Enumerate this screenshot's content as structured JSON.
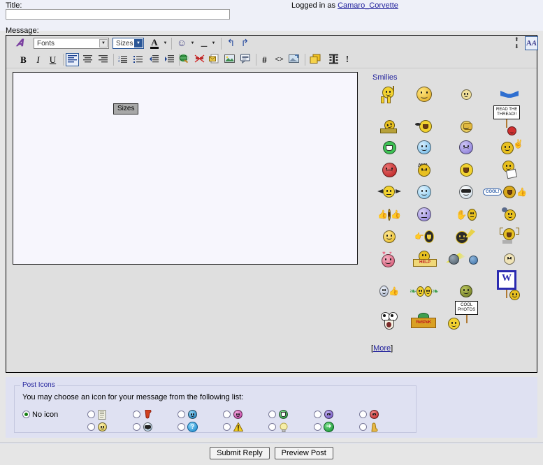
{
  "form": {
    "title_label": "Title:",
    "title_value": "",
    "title_placeholder": "",
    "message_label": "Message:",
    "logged_in_prefix": "Logged in as ",
    "logged_in_user": "Camaro_Corvette",
    "message_value": ""
  },
  "toolbar": {
    "logo_icon": "stylized-a-logo-icon",
    "fonts_select": "Fonts",
    "sizes_select": "Sizes",
    "tooltip": "Sizes",
    "row1": [
      {
        "name": "font-color-button",
        "icon": "underlined-a-icon",
        "label": "A"
      },
      {
        "name": "smilie-button",
        "icon": "smiley-icon",
        "label": "☺"
      },
      {
        "name": "attachment-button",
        "icon": "paperclip-icon",
        "label": "📎"
      },
      {
        "name": "undo-button",
        "icon": "undo-arrow-icon",
        "label": "↰"
      },
      {
        "name": "redo-button",
        "icon": "redo-arrow-icon",
        "label": "↱"
      }
    ],
    "row2": [
      {
        "name": "bold-button",
        "icon": "bold-icon",
        "label": "B"
      },
      {
        "name": "italic-button",
        "icon": "italic-icon",
        "label": "I"
      },
      {
        "name": "underline-button",
        "icon": "underline-icon",
        "label": "U"
      },
      {
        "name": "align-left-button",
        "icon": "align-left-icon",
        "label": ""
      },
      {
        "name": "align-center-button",
        "icon": "align-center-icon",
        "label": ""
      },
      {
        "name": "align-right-button",
        "icon": "align-right-icon",
        "label": ""
      },
      {
        "name": "ordered-list-button",
        "icon": "numbered-list-icon",
        "label": ""
      },
      {
        "name": "unordered-list-button",
        "icon": "bulleted-list-icon",
        "label": ""
      },
      {
        "name": "outdent-button",
        "icon": "outdent-icon",
        "label": ""
      },
      {
        "name": "indent-button",
        "icon": "indent-icon",
        "label": ""
      },
      {
        "name": "insert-link-button",
        "icon": "globe-link-icon",
        "label": ""
      },
      {
        "name": "remove-link-button",
        "icon": "broken-link-icon",
        "label": ""
      },
      {
        "name": "insert-email-button",
        "icon": "email-icon",
        "label": ""
      },
      {
        "name": "insert-image-button",
        "icon": "picture-icon",
        "label": ""
      },
      {
        "name": "insert-quote-button",
        "icon": "quote-bubble-icon",
        "label": ""
      },
      {
        "name": "insert-code-button",
        "icon": "hash-icon",
        "label": "#"
      },
      {
        "name": "insert-html-button",
        "icon": "angle-brackets-icon",
        "label": "<>"
      },
      {
        "name": "insert-thumbnail-button",
        "icon": "thumbnail-icon",
        "label": ""
      },
      {
        "name": "insert-layers-button",
        "icon": "layers-icon",
        "label": ""
      },
      {
        "name": "insert-video-button",
        "icon": "film-icon",
        "label": ""
      },
      {
        "name": "insert-bar-button",
        "icon": "exclamation-bar-icon",
        "label": "!"
      }
    ],
    "expand_icon": "expand-up-icon",
    "collapse_icon": "collapse-down-icon",
    "source_toggle_icon": "wysiwyg-source-toggle-icon",
    "source_toggle_label": "A/A"
  },
  "smilies": {
    "title": "Smilies",
    "more_label": "[More]",
    "more_text": "More",
    "rows": [
      [
        {
          "name": "smilie-wave-guy",
          "kind": "face-walk",
          "color": "#f2d230"
        },
        {
          "name": "smilie-plain-smile",
          "kind": "face",
          "color": "#f2c230",
          "size": 22
        },
        {
          "name": "smilie-small-smile",
          "kind": "face",
          "color": "#f0df9a",
          "size": 15
        },
        {
          "name": "smilie-chevy-bowtie",
          "kind": "bowtie",
          "color": "#2f6fd0"
        }
      ],
      [
        {
          "name": "smilie-typing",
          "kind": "face-tilt",
          "color": "#e8c020"
        },
        {
          "name": "smilie-spit-take",
          "kind": "face-spin",
          "color": "#f2d230"
        },
        {
          "name": "smilie-facepalm",
          "kind": "face-palm",
          "color": "#e8cc60"
        },
        {
          "name": "smilie-read-the-thread",
          "kind": "sign",
          "text": "READ THE\nTHREAD!!",
          "color": "#d03030"
        }
      ],
      [
        {
          "name": "smilie-green-grin",
          "kind": "face-teeth",
          "color": "#3fc255"
        },
        {
          "name": "smilie-blue-smile",
          "kind": "face",
          "color": "#8ecbf0",
          "size": 20
        },
        {
          "name": "smilie-purple-mad",
          "kind": "face-frown",
          "color": "#9b8fe0",
          "size": 20
        },
        {
          "name": "smilie-wink-wave",
          "kind": "face-wave",
          "color": "#e8c020"
        }
      ],
      [
        {
          "name": "smilie-red-angry",
          "kind": "face-frown",
          "color": "#cf3030",
          "size": 22
        },
        {
          "name": "smilie-mad-hair",
          "kind": "face-hair",
          "color": "#e8c020"
        },
        {
          "name": "smilie-laugh",
          "kind": "face-open",
          "color": "#f2d230",
          "size": 19
        },
        {
          "name": "smilie-writing",
          "kind": "face-note",
          "color": "#e8c020"
        }
      ],
      [
        {
          "name": "smilie-squeezed",
          "kind": "face-squeeze",
          "color": "#f2d230"
        },
        {
          "name": "smilie-blue-big-smile",
          "kind": "face",
          "color": "#9ed6f5",
          "size": 20
        },
        {
          "name": "smilie-sunglasses",
          "kind": "face-shades",
          "color": "#dfe8ee",
          "size": 20
        },
        {
          "name": "smilie-cool-bubble",
          "kind": "cool",
          "text": "COOL!",
          "color": "#d8a81c"
        }
      ],
      [
        {
          "name": "smilie-thumbs-both",
          "kind": "face-thumbs",
          "color": "#d8a81c"
        },
        {
          "name": "smilie-purple-dots",
          "kind": "face",
          "color": "#9b8fe0",
          "size": 20
        },
        {
          "name": "smilie-hand-think",
          "kind": "face-hand",
          "color": "#e8c020"
        },
        {
          "name": "smilie-small-spin",
          "kind": "face-tiny-spin",
          "color": "#e8c020"
        }
      ],
      [
        {
          "name": "smilie-basic-smile",
          "kind": "face",
          "color": "#f2c230",
          "size": 18
        },
        {
          "name": "smilie-shout-dark",
          "kind": "face-shout",
          "color": "#2a2a2a"
        },
        {
          "name": "smilie-throw",
          "kind": "face-throw",
          "color": "#2a2a2a"
        },
        {
          "name": "smilie-cheer",
          "kind": "face-cheer",
          "color": "#e8c020"
        }
      ],
      [
        {
          "name": "smilie-love-hearts",
          "kind": "face-hearts",
          "color": "#e06a86"
        },
        {
          "name": "smilie-help-sign",
          "kind": "help",
          "text": "HELP",
          "color": "#e8c020"
        },
        {
          "name": "smilie-comet",
          "kind": "comet",
          "color": "#6a7a86"
        },
        {
          "name": "smilie-pale-sick",
          "kind": "face",
          "color": "#efe3b6",
          "size": 16
        }
      ],
      [
        {
          "name": "smilie-thumb-up-grey",
          "kind": "face-thumbup",
          "color": "#c9cfe0"
        },
        {
          "name": "smilie-two-faces",
          "kind": "face-pair",
          "color": "#f2d230"
        },
        {
          "name": "smilie-dark-smile",
          "kind": "face",
          "color": "#7e8a2a",
          "size": 18
        },
        {
          "name": "smilie-w-sign",
          "kind": "wsign",
          "text": "W",
          "color": "#2a2ab0"
        }
      ],
      [
        {
          "name": "smilie-shocked",
          "kind": "face-shock",
          "color": "#f4f4f4"
        },
        {
          "name": "smilie-respek",
          "kind": "respek",
          "text": "ReSPeK",
          "color": "#d9a023"
        },
        {
          "name": "smilie-cool-photos",
          "kind": "sign2",
          "text": "COOL\nPHOTOS",
          "color": "#f2d230"
        },
        {
          "name": "smilie-empty",
          "kind": "none"
        }
      ]
    ]
  },
  "post_icons": {
    "legend": "Post Icons",
    "help_text": "You may choose an icon for your message from the following list:",
    "no_icon_label": "No icon",
    "no_icon_selected": true,
    "items_row1": [
      {
        "name": "posticon-notes",
        "icon": "notepad-icon",
        "glyph": "▤",
        "color": "#d8d8c0"
      },
      {
        "name": "posticon-thumbs-down",
        "icon": "thumbs-down-icon",
        "glyph": "●",
        "color": "#d0401f"
      },
      {
        "name": "posticon-blue-smile",
        "icon": "blue-smiley-icon",
        "glyph": "●",
        "color": "#1f8fd0"
      },
      {
        "name": "posticon-pink-smile",
        "icon": "pink-smiley-icon",
        "glyph": "●",
        "color": "#d050a8"
      },
      {
        "name": "posticon-green-grin",
        "icon": "green-grin-icon",
        "glyph": "●",
        "color": "#2fae46"
      },
      {
        "name": "posticon-purple-mad",
        "icon": "purple-mad-icon",
        "glyph": "●",
        "color": "#7d5fd0"
      },
      {
        "name": "posticon-red-angry",
        "icon": "red-angry-icon",
        "glyph": "●",
        "color": "#cf3030"
      }
    ],
    "items_row2": [
      {
        "name": "posticon-yellow-smile",
        "icon": "yellow-smiley-icon",
        "glyph": "●",
        "color": "#e8d060"
      },
      {
        "name": "posticon-sunglasses",
        "icon": "sunglasses-smiley-icon",
        "glyph": "●",
        "color": "#cfe0ee"
      },
      {
        "name": "posticon-question",
        "icon": "question-mark-icon",
        "glyph": "?",
        "color": "#20a0e0"
      },
      {
        "name": "posticon-warning",
        "icon": "warning-triangle-icon",
        "glyph": "!",
        "color": "#f0cf20"
      },
      {
        "name": "posticon-lightbulb",
        "icon": "lightbulb-icon",
        "glyph": "●",
        "color": "#f3eaa0"
      },
      {
        "name": "posticon-arrow",
        "icon": "green-arrow-icon",
        "glyph": "➜",
        "color": "#11a23b"
      },
      {
        "name": "posticon-thumbs-up",
        "icon": "thumbs-up-icon",
        "glyph": "✋",
        "color": "#e8b848"
      }
    ]
  },
  "footer": {
    "submit_label": "Submit Reply",
    "preview_label": "Preview Post"
  }
}
